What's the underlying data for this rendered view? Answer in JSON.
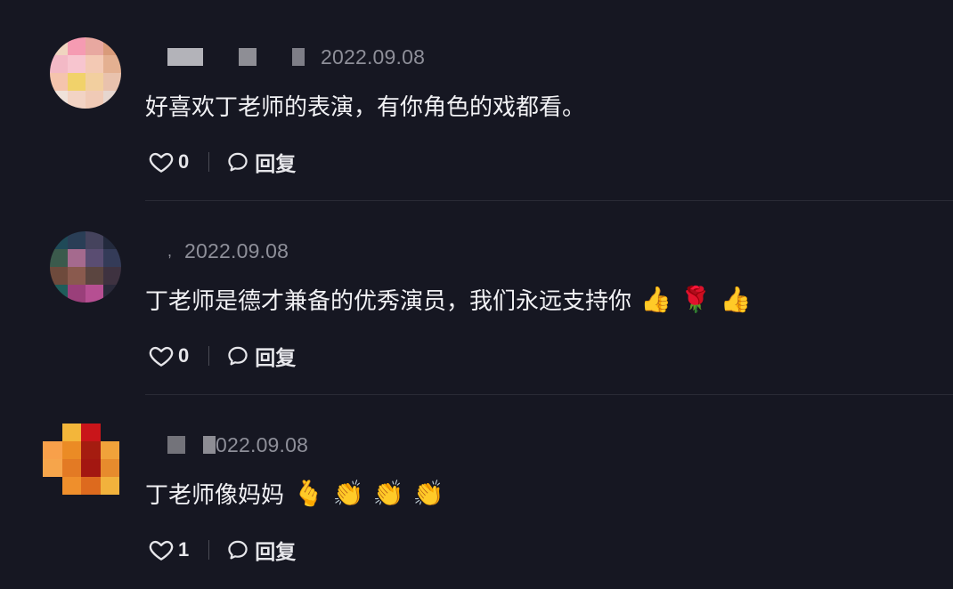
{
  "comments": [
    {
      "date": "2022.09.08",
      "text": "好喜欢丁老师的表演，有你角色的戏都看。",
      "emojis": [],
      "likes": "0",
      "reply_label": "回复",
      "avatar_colors": [
        "#f0d5c0",
        "#f59bb2",
        "#e8a8a0",
        "#d99b7a",
        "#f3b9c6",
        "#f7c5cf",
        "#f3c9b4",
        "#e4b091",
        "#f5c4ad",
        "#f1d26a",
        "#f2cf9f",
        "#e9c2ad",
        "#efe2da",
        "#f2d3c4",
        "#f0cab6",
        "#e6d6cf"
      ]
    },
    {
      "date": "2022.09.08",
      "text": "丁老师是德才兼备的优秀演员，我们永远支持你",
      "emojis": [
        "👍",
        "🌹",
        "👍"
      ],
      "likes": "0",
      "reply_label": "回复",
      "avatar_colors": [
        "#1f4a58",
        "#2a3e56",
        "#45435d",
        "#232a3d",
        "#3b5a4c",
        "#a56a8e",
        "#5a4d72",
        "#343b58",
        "#6e4a3c",
        "#8a5a4e",
        "#5b4540",
        "#3e3240",
        "#1f5d5a",
        "#9a3f7a",
        "#b64f92",
        "#2a2a3a"
      ]
    },
    {
      "date": "022.09.08",
      "text": "丁老师像妈妈",
      "emojis": [
        "🫰",
        "👏",
        "👏",
        "👏"
      ],
      "likes": "1",
      "reply_label": "回复",
      "avatar_colors": [
        "#161722",
        "#f3b63a",
        "#c9151a",
        "#161722",
        "#f8a04a",
        "#eb8b25",
        "#a51c10",
        "#f0a23a",
        "#f6a54b",
        "#e37a24",
        "#a31711",
        "#e78b2d",
        "#161722",
        "#ef8f2c",
        "#dd6a1e",
        "#f2b23c"
      ]
    }
  ]
}
